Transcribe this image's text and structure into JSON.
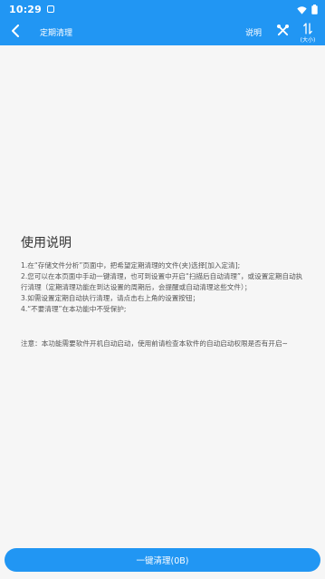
{
  "status_bar": {
    "time": "10:29"
  },
  "app_bar": {
    "title": "定期清理",
    "help_label": "说明",
    "size_label": "(大小)"
  },
  "help": {
    "title": "使用说明",
    "items": [
      "1.在“存储文件分析”页面中，把希望定期清理的文件(夹)选择[加入定清];",
      "2.您可以在本页面中手动一键清理，也可到设置中开启“扫描后自动清理”，或设置定期自动执行清理（定期清理功能在到达设置的周期后，会提醒或自动清理这些文件）；",
      "3.如需设置定期自动执行清理，请点击右上角的设置按钮；",
      "4.“不要清理”在本功能中不受保护;"
    ],
    "note": "注意：本功能需要软件开机自动启动，使用前请检查本软件的自动启动权限是否有开启~"
  },
  "clean_button": {
    "label": "一键清理(0B)"
  },
  "colors": {
    "primary": "#2196f3",
    "background": "#f6f6f6",
    "title_text": "#333333",
    "body_text": "#555555"
  },
  "icons": {
    "status_notification": "notification-icon",
    "wifi": "wifi-icon",
    "battery": "battery-icon",
    "back": "back-arrow-icon",
    "settings": "tools-icon",
    "sort": "sort-arrows-icon"
  }
}
